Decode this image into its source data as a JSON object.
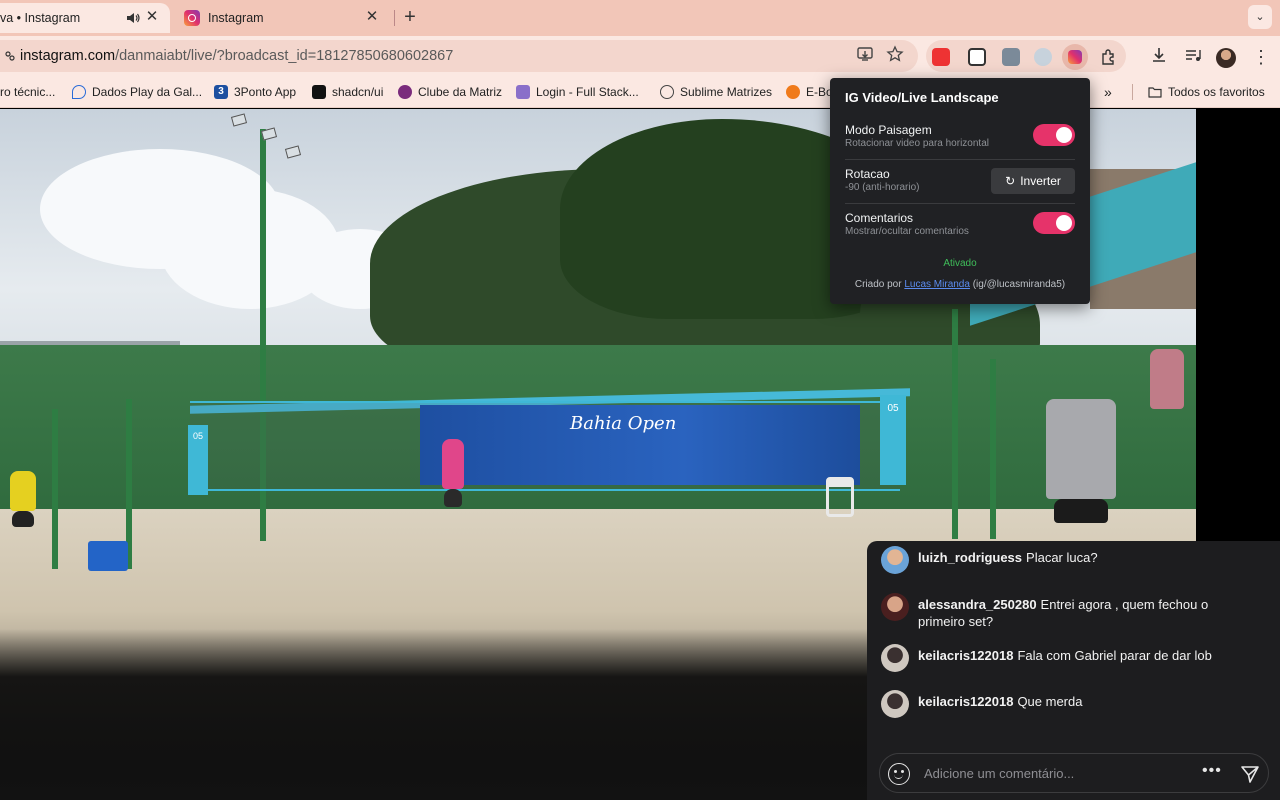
{
  "tabs": [
    {
      "label": "va • Instagram",
      "audible": true,
      "active": true
    },
    {
      "label": "Instagram",
      "active": false
    }
  ],
  "address_bar": {
    "host": "instagram.com",
    "path": "/danmaiabt/live/?broadcast_id=18127850680602867"
  },
  "bookmarks": [
    {
      "label": "ro técnic..."
    },
    {
      "label": "Dados Play da Gal..."
    },
    {
      "label": "3Ponto App",
      "icon_text": "3"
    },
    {
      "label": "shadcn/ui"
    },
    {
      "label": "Clube da Matriz"
    },
    {
      "label": "Login - Full Stack..."
    },
    {
      "label": "Sublime Matrizes"
    },
    {
      "label": "E-Bo"
    },
    {
      "label": "»"
    },
    {
      "label": "Todos os favoritos"
    }
  ],
  "popup": {
    "title": "IG Video/Live Landscape",
    "rows": [
      {
        "label": "Modo Paisagem",
        "sub": "Rotacionar video para horizontal",
        "control": "toggle",
        "on": true
      },
      {
        "label": "Rotacao",
        "sub": "-90 (anti-horario)",
        "control": "button",
        "button_label": "Inverter"
      },
      {
        "label": "Comentarios",
        "sub": "Mostrar/ocultar comentarios",
        "control": "toggle",
        "on": true
      }
    ],
    "status": "Ativado",
    "credit_prefix": "Criado por ",
    "credit_link": "Lucas Miranda",
    "credit_suffix": " (ig/@lucasmiranda5)",
    "accent_color": "#e6336a",
    "status_color": "#3fbf5a"
  },
  "video_scene": {
    "banner_text": "Bahia Open",
    "net_number": "05"
  },
  "comments": {
    "items": [
      {
        "user": "luizh_rodriguess",
        "text": "Placar luca?"
      },
      {
        "user": "alessandra_250280",
        "text": "Entrei agora , quem fechou o primeiro set?"
      },
      {
        "user": "keilacris122018",
        "text": "Fala com Gabriel parar de dar lob"
      },
      {
        "user": "keilacris122018",
        "text": "Que merda"
      }
    ],
    "input_placeholder": "Adicione um comentário..."
  }
}
